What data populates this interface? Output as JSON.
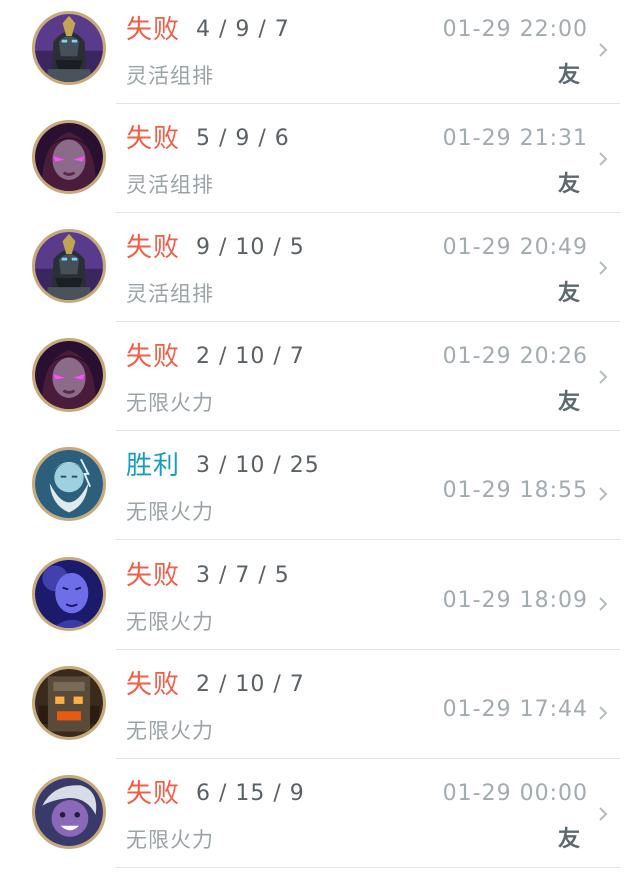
{
  "colors": {
    "loss": "#f25d45",
    "win": "#1a9dbc"
  },
  "matches": [
    {
      "result": "失败",
      "outcome": "loss",
      "kda": "4 / 9 / 7",
      "mode": "灵活组排",
      "time": "01-29 22:00",
      "friend": "友",
      "champion_icon": "dark-armored-knight-icon"
    },
    {
      "result": "失败",
      "outcome": "loss",
      "kda": "5 / 9 / 6",
      "mode": "灵活组排",
      "time": "01-29 21:31",
      "friend": "友",
      "champion_icon": "violet-eyed-woman-icon"
    },
    {
      "result": "失败",
      "outcome": "loss",
      "kda": "9 / 10 / 5",
      "mode": "灵活组排",
      "time": "01-29 20:49",
      "friend": "友",
      "champion_icon": "dark-armored-knight-icon"
    },
    {
      "result": "失败",
      "outcome": "loss",
      "kda": "2 / 10 / 7",
      "mode": "无限火力",
      "time": "01-29 20:26",
      "friend": "友",
      "champion_icon": "violet-eyed-woman-icon"
    },
    {
      "result": "胜利",
      "outcome": "win",
      "kda": "3 / 10 / 25",
      "mode": "无限火力",
      "time": "01-29 18:55",
      "friend": null,
      "champion_icon": "bearded-storm-god-icon"
    },
    {
      "result": "失败",
      "outcome": "loss",
      "kda": "3 / 7 / 5",
      "mode": "无限火力",
      "time": "01-29 18:09",
      "friend": null,
      "champion_icon": "blue-glowing-monk-icon"
    },
    {
      "result": "失败",
      "outcome": "loss",
      "kda": "2 / 10 / 7",
      "mode": "无限火力",
      "time": "01-29 17:44",
      "friend": null,
      "champion_icon": "molten-golem-icon"
    },
    {
      "result": "失败",
      "outcome": "loss",
      "kda": "6 / 15 / 9",
      "mode": "无限火力",
      "time": "01-29 00:00",
      "friend": "友",
      "champion_icon": "grinning-imp-icon"
    }
  ]
}
